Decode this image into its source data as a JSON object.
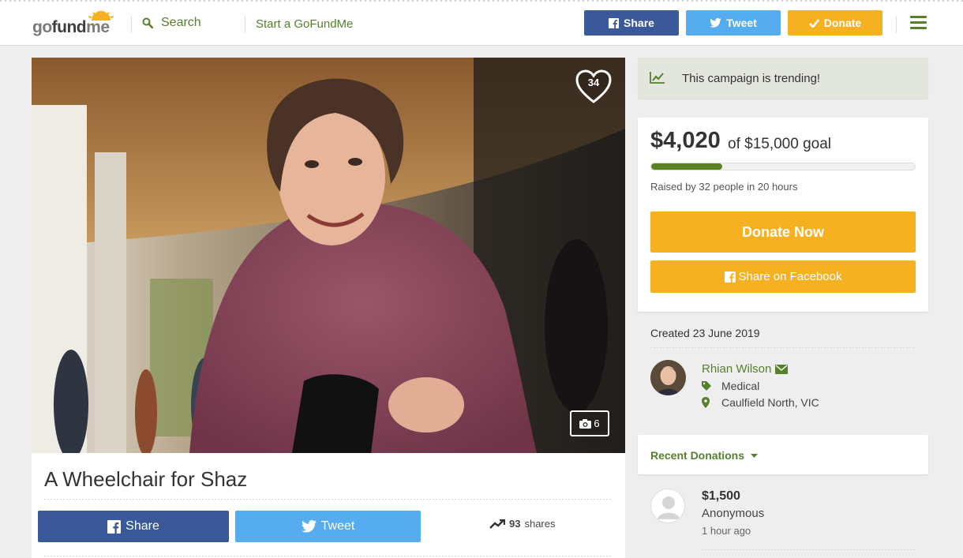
{
  "header": {
    "logo": "gofundme",
    "search_label": "Search",
    "start_label": "Start a GoFundMe",
    "share_label": "Share",
    "tweet_label": "Tweet",
    "donate_label": "Donate",
    "icons": {
      "search": "search-icon",
      "facebook": "facebook-icon",
      "twitter": "twitter-icon",
      "check": "check-icon",
      "menu": "hamburger-menu-icon"
    }
  },
  "hero": {
    "heart_count": "34",
    "photo_count": "6"
  },
  "campaign": {
    "title": "A Wheelchair for Shaz",
    "share_label": "Share",
    "tweet_label": "Tweet",
    "shares_count": "93",
    "shares_label": "shares"
  },
  "sidebar": {
    "trending": "This campaign is trending!",
    "raised": "$4,020",
    "goal": "of $15,000 goal",
    "progress_fraction": 0.268,
    "raised_by": "Raised by 32 people in 20 hours",
    "donate_now": "Donate Now",
    "share_facebook": "Share on Facebook",
    "created": "Created 23 June 2019",
    "organizer": {
      "name": "Rhian Wilson",
      "category": "Medical",
      "location": "Caulfield North, VIC"
    },
    "recent_donations_label": "Recent Donations",
    "donations": [
      {
        "amount": "$1,500",
        "name": "Anonymous",
        "time": "1 hour ago"
      }
    ]
  },
  "colors": {
    "brand_green": "#55802d",
    "donate_orange": "#f5b122",
    "facebook_blue": "#3b5998",
    "twitter_blue": "#55acee",
    "progress_green": "#5a8220"
  }
}
